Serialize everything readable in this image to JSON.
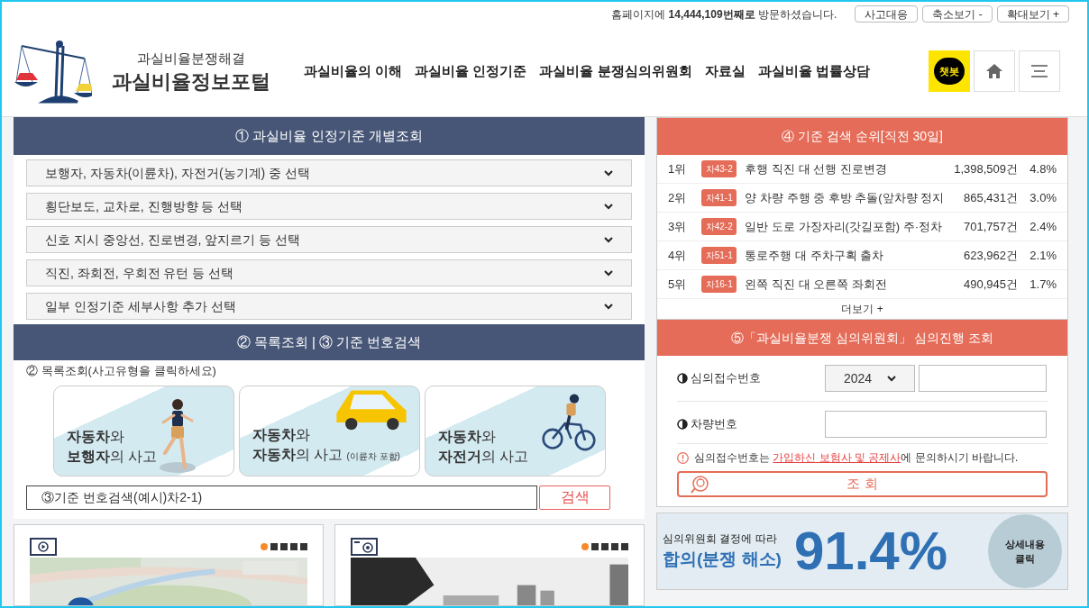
{
  "counter": "홈페이지에 **14,444,109번째로** 방문하셨습니다.",
  "top_buttons": [
    "사고대응",
    "축소보기 -",
    "확대보기 +"
  ],
  "logo": {
    "subtitle": "과실비율분쟁해결",
    "title": "과실비율정보포털"
  },
  "nav": [
    "과실비율의 이해",
    "과실비율 인정기준",
    "과실비율 분쟁심의위원회",
    "자료실",
    "과실비율 법률상담"
  ],
  "chatbot": "챗봇",
  "section1": {
    "title": "① 과실비율 인정기준 개별조회",
    "selects": [
      "보행자, 자동차(이륜차), 자전거(농기계) 중 선택",
      "횡단보도, 교차로, 진행방향 등 선택",
      "신호 지시 중앙선, 진로변경, 앞지르기 등 선택",
      "직진, 좌회전, 우회전 유턴 등 선택",
      "일부 인정기준 세부사항 추가 선택"
    ]
  },
  "section2": {
    "title": "② 목록조회 | ③ 기준 번호검색",
    "list_label": "② 목록조회(사고유형을 클릭하세요)",
    "cards": [
      {
        "kind": "pedestrian",
        "line1_bold": "자동차",
        "line1": "와",
        "line2_bold": "보행자",
        "line2": "의 사고"
      },
      {
        "kind": "car",
        "line1_bold": "자동차",
        "line1": "와",
        "line2_bold": "자동차",
        "line2": "의 사고",
        "note": "(이륜차 포함)"
      },
      {
        "kind": "bicycle",
        "line1_bold": "자동차",
        "line1": "와",
        "line2_bold": "자전거",
        "line2": "의 사고"
      }
    ],
    "search_placeholder": "③기준 번호검색(예시)차2-1)",
    "search_button": "검색"
  },
  "media": [
    {
      "kind": "video",
      "dots": [
        true,
        false,
        false,
        false,
        false
      ]
    },
    {
      "kind": "camera",
      "dots": [
        true,
        false,
        false,
        false,
        false
      ]
    }
  ],
  "ranking": {
    "title": "④ 기준 검색 순위[직전 30일]",
    "rows": [
      {
        "rank": "1위",
        "code": "차43-2",
        "title": "후행 직진 대 선행 진로변경",
        "count": "1,398,509건",
        "percent": "4.8%"
      },
      {
        "rank": "2위",
        "code": "차41-1",
        "title": "양 차량 주행 중 후방 추돌(앞차량 정지",
        "count": "865,431건",
        "percent": "3.0%"
      },
      {
        "rank": "3위",
        "code": "차42-2",
        "title": "일반 도로 가장자리(갓길포함) 주·정차",
        "count": "701,757건",
        "percent": "2.4%"
      },
      {
        "rank": "4위",
        "code": "차51-1",
        "title": "통로주행 대 주차구획 출차",
        "count": "623,962건",
        "percent": "2.1%"
      },
      {
        "rank": "5위",
        "code": "차16-1",
        "title": "왼쪽 직진 대 오른쪽 좌회전",
        "count": "490,945건",
        "percent": "1.7%"
      }
    ],
    "more": "더보기 +"
  },
  "committee": {
    "title": "⑤「과실비율분쟁 심의위원회」 심의진행 조회",
    "receipt_label": "심의접수번호",
    "year": "2024",
    "vehicle_label": "차량번호",
    "notice_before": "심의접수번호는 ",
    "notice_link": "가입하신 보험사 및 공제사",
    "notice_after": "에 문의하시기 바랍니다.",
    "button": "조 회"
  },
  "banner": {
    "line1": "심의위원회 결정에 따라",
    "line2": "합의(분쟁 해소)",
    "figure": "91.4%",
    "circle": [
      "상세내용",
      "클릭"
    ]
  }
}
